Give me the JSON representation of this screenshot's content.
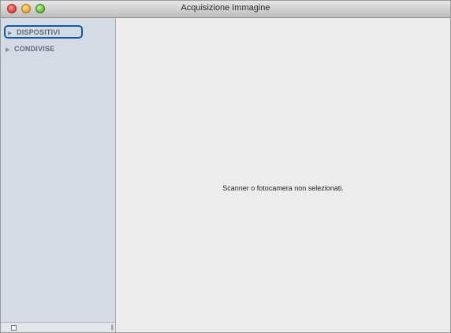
{
  "window": {
    "title": "Acquisizione Immagine"
  },
  "sidebar": {
    "sections": [
      {
        "label": "DISPOSITIVI",
        "expanded": false,
        "highlighted": true
      },
      {
        "label": "CONDIVISE",
        "expanded": false,
        "highlighted": false
      }
    ]
  },
  "main": {
    "empty_message": "Scanner o fotocamera non selezionati."
  },
  "colors": {
    "sidebar_bg": "#d4dbe5",
    "highlight_border": "#0c5aa6",
    "main_bg": "#ececec"
  },
  "icons": {
    "disclosure": "triangle-right-icon",
    "add": "add-device-icon",
    "resize": "resize-grip-icon"
  }
}
